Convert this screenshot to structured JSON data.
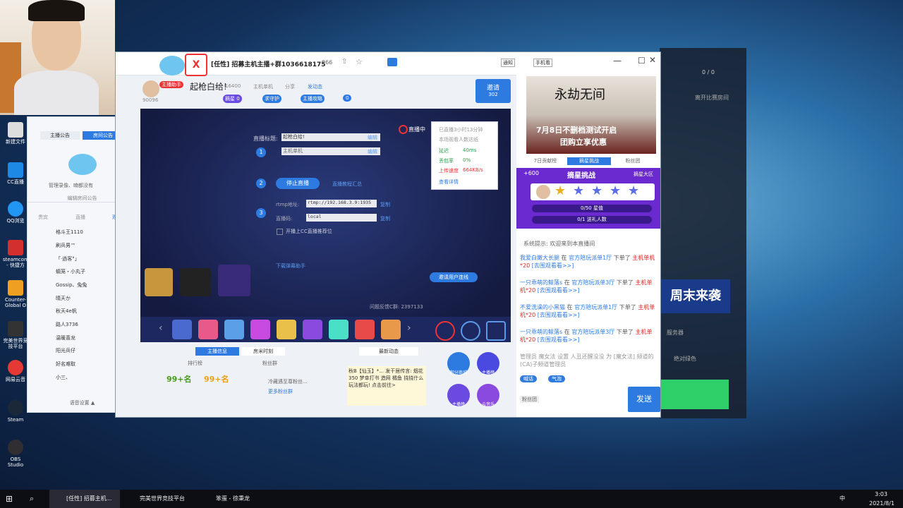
{
  "taskbar": {
    "items": [
      {
        "label": "[任性] 招募主机..."
      },
      {
        "label": "完美世界竞技平台"
      },
      {
        "label": "笨蛋 - 徐秉龙"
      }
    ],
    "clock_time": "3:03",
    "clock_date": "2021/8/1",
    "lang": "中"
  },
  "desktop": {
    "icons": [
      {
        "label": "新建文件"
      },
      {
        "label": "CC直播"
      },
      {
        "label": "QQ浏览"
      },
      {
        "label": "steamcom - 快捷方"
      },
      {
        "label": "Counter-Global O"
      },
      {
        "label": "完美世界竞技平台"
      },
      {
        "label": "网易云音"
      },
      {
        "label": "Steam"
      },
      {
        "label": "OBS Studio"
      }
    ]
  },
  "left_panel": {
    "tabs": [
      "主播公告",
      "房间公告"
    ],
    "notice_text": "管理录像、喃都没有",
    "edit_notice": "编辑房间公告",
    "user_tabs": [
      "贵宾",
      "直播",
      "观看"
    ],
    "users": [
      "格斗王1110",
      "刷兵男™",
      "「·過客°」",
      "蜻笼・小丸子",
      "Gossip、兔兔",
      "晴天か",
      "秋天4e帆",
      "路人3736",
      "温暖喜龙",
      "阳光兵仔",
      "好名难取",
      "小三、"
    ],
    "footer": "语音设置 ▲"
  },
  "main": {
    "title": "[任性] 招募主机主播+群1036618175",
    "viewers": "966",
    "notice_btn": "通知",
    "phone_btn": "手机看",
    "streamer_title": "起枪白给!",
    "streamer_id": "90096",
    "badge_assist": "主播助手",
    "heat": "16400",
    "console_label": "主机单机",
    "share_label": "分享",
    "activity_label": "发动态",
    "tag_follow": "摘星 0",
    "tag_guard": "求守护",
    "tag_guide": "主播攻略",
    "tag_count": "0",
    "invite_label": "邀请",
    "invite_count": "302",
    "live_status": "直播中",
    "form": {
      "title_label": "直播标题:",
      "title_value": "起枪白给!",
      "edit": "编辑",
      "category_value": "主机单机",
      "stop_btn": "停止直播",
      "tutorial": "直播教程汇总",
      "rtmp_label": "rtmp地址:",
      "rtmp_value": "rtmp://192.168.3.9:1935",
      "key_label": "直播码:",
      "key_value": "local",
      "copy": "复制",
      "recommend": "开播上CC直播推荐位",
      "download_helper": "下载弹幕助手",
      "feedback": "问题反馈C群: 2397133",
      "link_btn": "邀请用户连线"
    },
    "stats": {
      "duration": "已直播3小时13分钟",
      "viewers_note": "本场观看人数达纸",
      "latency_label": "延迟",
      "latency_value": "40ms",
      "loss_label": "丢包率",
      "loss_value": "0%",
      "upload_label": "上传速度",
      "upload_value": "664KB/s",
      "detail": "查看详情"
    },
    "bottom_tabs": [
      "主播信息",
      "房米时刻",
      "最新动态"
    ],
    "rank_label": "排行榜",
    "fan_label": "粉丝群",
    "rank1": "99+名",
    "rank2": "99+名",
    "fan_note": "冷藏遇至尊粉丝...",
    "fan_link": "更多粉丝群",
    "dynamic_text": "秋B【仙玉】*... 发干居传言: 烟花350 梦幸打书 造网 橘鱼 挠挠什么玩法都玩! 点击前往>",
    "gift_labels": [
      "积分商城",
      "主播榜",
      "主播榜",
      "云音乐"
    ]
  },
  "right_col": {
    "ad_title": "永劫无间",
    "ad_line1": "7月8日不删档测试开启",
    "ad_line2": "团购立享优惠",
    "tabs": [
      "7日贡献榜",
      "摘星挑战",
      "粉丝团"
    ],
    "challenge_title": "摘星挑战",
    "challenge_plus": "+600",
    "challenge_link": "摘星大区",
    "star_progress": "0/50 星值",
    "gift_progress": "0/1 送礼人数",
    "welcome": "系统提示: 欢迎来到本直播间",
    "chat": [
      {
        "user": "我爱白嫩大长腿",
        "mid": "在",
        "place": "官方陪玩派单1厅",
        "act": "下单了",
        "item": "主机单机*20",
        "link": "[去围观看看>>]"
      },
      {
        "user": "一只乖萌的鲸落s",
        "mid": "在",
        "place": "官方陪玩派单3厅",
        "act": "下单了",
        "item": "主机单机*20",
        "link": "[去围观看看>>]"
      },
      {
        "user": "不爱洗澡的小黑猫",
        "mid": "在",
        "place": "官方陪玩派单1厅",
        "act": "下单了",
        "item": "主机单机*20",
        "link": "[去围观看看>>]"
      },
      {
        "user": "一只乖萌的鲸落s",
        "mid": "在",
        "place": "官方陪玩派单3厅",
        "act": "下单了",
        "item": "主机单机*20",
        "link": "[去围观看看>>]"
      }
    ],
    "admin_note": "管理员 魔女法 设置 人丑还醒没没 为 [魔女法] 频道的(CA)子频道管理员",
    "send_btn": "发送",
    "chip1": "喊话",
    "chip2": "气泡",
    "fan_chip": "粉丝团"
  },
  "bg_window": {
    "room_count": "0 / 0",
    "leave_btn": "离开比赛房间",
    "banner": "周末来袭",
    "server_label": "服务器",
    "green_label": "绝对绿色"
  }
}
